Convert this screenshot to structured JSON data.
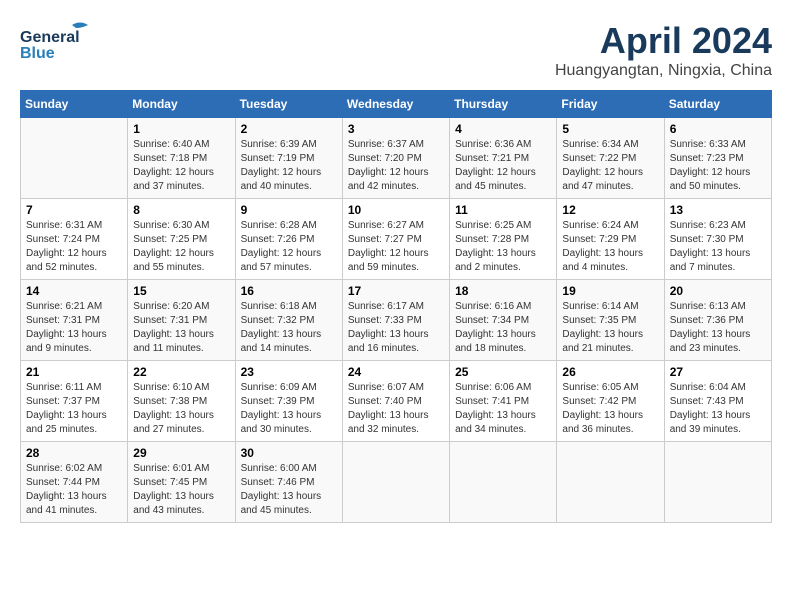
{
  "header": {
    "logo_line1": "General",
    "logo_line2": "Blue",
    "title": "April 2024",
    "subtitle": "Huangyangtan, Ningxia, China"
  },
  "calendar": {
    "days_of_week": [
      "Sunday",
      "Monday",
      "Tuesday",
      "Wednesday",
      "Thursday",
      "Friday",
      "Saturday"
    ],
    "weeks": [
      [
        {
          "day": "",
          "info": ""
        },
        {
          "day": "1",
          "info": "Sunrise: 6:40 AM\nSunset: 7:18 PM\nDaylight: 12 hours\nand 37 minutes."
        },
        {
          "day": "2",
          "info": "Sunrise: 6:39 AM\nSunset: 7:19 PM\nDaylight: 12 hours\nand 40 minutes."
        },
        {
          "day": "3",
          "info": "Sunrise: 6:37 AM\nSunset: 7:20 PM\nDaylight: 12 hours\nand 42 minutes."
        },
        {
          "day": "4",
          "info": "Sunrise: 6:36 AM\nSunset: 7:21 PM\nDaylight: 12 hours\nand 45 minutes."
        },
        {
          "day": "5",
          "info": "Sunrise: 6:34 AM\nSunset: 7:22 PM\nDaylight: 12 hours\nand 47 minutes."
        },
        {
          "day": "6",
          "info": "Sunrise: 6:33 AM\nSunset: 7:23 PM\nDaylight: 12 hours\nand 50 minutes."
        }
      ],
      [
        {
          "day": "7",
          "info": "Sunrise: 6:31 AM\nSunset: 7:24 PM\nDaylight: 12 hours\nand 52 minutes."
        },
        {
          "day": "8",
          "info": "Sunrise: 6:30 AM\nSunset: 7:25 PM\nDaylight: 12 hours\nand 55 minutes."
        },
        {
          "day": "9",
          "info": "Sunrise: 6:28 AM\nSunset: 7:26 PM\nDaylight: 12 hours\nand 57 minutes."
        },
        {
          "day": "10",
          "info": "Sunrise: 6:27 AM\nSunset: 7:27 PM\nDaylight: 12 hours\nand 59 minutes."
        },
        {
          "day": "11",
          "info": "Sunrise: 6:25 AM\nSunset: 7:28 PM\nDaylight: 13 hours\nand 2 minutes."
        },
        {
          "day": "12",
          "info": "Sunrise: 6:24 AM\nSunset: 7:29 PM\nDaylight: 13 hours\nand 4 minutes."
        },
        {
          "day": "13",
          "info": "Sunrise: 6:23 AM\nSunset: 7:30 PM\nDaylight: 13 hours\nand 7 minutes."
        }
      ],
      [
        {
          "day": "14",
          "info": "Sunrise: 6:21 AM\nSunset: 7:31 PM\nDaylight: 13 hours\nand 9 minutes."
        },
        {
          "day": "15",
          "info": "Sunrise: 6:20 AM\nSunset: 7:31 PM\nDaylight: 13 hours\nand 11 minutes."
        },
        {
          "day": "16",
          "info": "Sunrise: 6:18 AM\nSunset: 7:32 PM\nDaylight: 13 hours\nand 14 minutes."
        },
        {
          "day": "17",
          "info": "Sunrise: 6:17 AM\nSunset: 7:33 PM\nDaylight: 13 hours\nand 16 minutes."
        },
        {
          "day": "18",
          "info": "Sunrise: 6:16 AM\nSunset: 7:34 PM\nDaylight: 13 hours\nand 18 minutes."
        },
        {
          "day": "19",
          "info": "Sunrise: 6:14 AM\nSunset: 7:35 PM\nDaylight: 13 hours\nand 21 minutes."
        },
        {
          "day": "20",
          "info": "Sunrise: 6:13 AM\nSunset: 7:36 PM\nDaylight: 13 hours\nand 23 minutes."
        }
      ],
      [
        {
          "day": "21",
          "info": "Sunrise: 6:11 AM\nSunset: 7:37 PM\nDaylight: 13 hours\nand 25 minutes."
        },
        {
          "day": "22",
          "info": "Sunrise: 6:10 AM\nSunset: 7:38 PM\nDaylight: 13 hours\nand 27 minutes."
        },
        {
          "day": "23",
          "info": "Sunrise: 6:09 AM\nSunset: 7:39 PM\nDaylight: 13 hours\nand 30 minutes."
        },
        {
          "day": "24",
          "info": "Sunrise: 6:07 AM\nSunset: 7:40 PM\nDaylight: 13 hours\nand 32 minutes."
        },
        {
          "day": "25",
          "info": "Sunrise: 6:06 AM\nSunset: 7:41 PM\nDaylight: 13 hours\nand 34 minutes."
        },
        {
          "day": "26",
          "info": "Sunrise: 6:05 AM\nSunset: 7:42 PM\nDaylight: 13 hours\nand 36 minutes."
        },
        {
          "day": "27",
          "info": "Sunrise: 6:04 AM\nSunset: 7:43 PM\nDaylight: 13 hours\nand 39 minutes."
        }
      ],
      [
        {
          "day": "28",
          "info": "Sunrise: 6:02 AM\nSunset: 7:44 PM\nDaylight: 13 hours\nand 41 minutes."
        },
        {
          "day": "29",
          "info": "Sunrise: 6:01 AM\nSunset: 7:45 PM\nDaylight: 13 hours\nand 43 minutes."
        },
        {
          "day": "30",
          "info": "Sunrise: 6:00 AM\nSunset: 7:46 PM\nDaylight: 13 hours\nand 45 minutes."
        },
        {
          "day": "",
          "info": ""
        },
        {
          "day": "",
          "info": ""
        },
        {
          "day": "",
          "info": ""
        },
        {
          "day": "",
          "info": ""
        }
      ]
    ]
  }
}
